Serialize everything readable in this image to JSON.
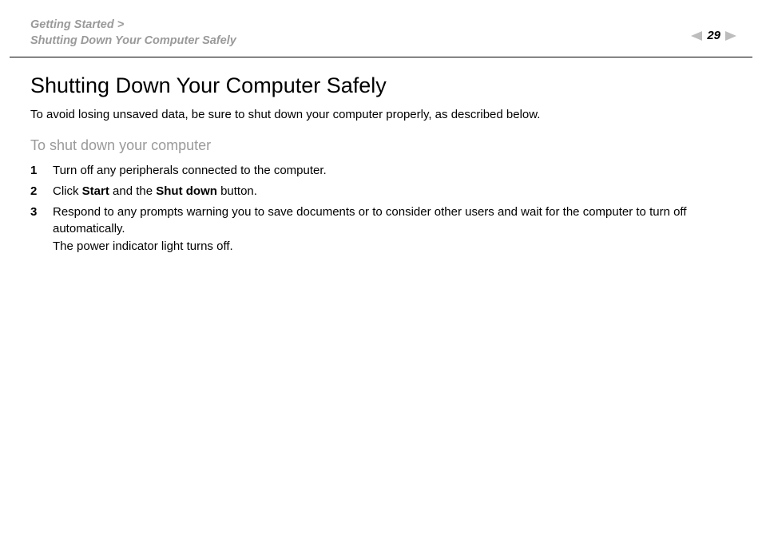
{
  "header": {
    "breadcrumb_line1": "Getting Started >",
    "breadcrumb_line2": "Shutting Down Your Computer Safely",
    "page_number": "29"
  },
  "main": {
    "title": "Shutting Down Your Computer Safely",
    "intro": "To avoid losing unsaved data, be sure to shut down your computer properly, as described below.",
    "subtitle": "To shut down your computer",
    "steps": {
      "n1": "1",
      "t1": "Turn off any peripherals connected to the computer.",
      "n2": "2",
      "t2a": "Click ",
      "t2b": "Start",
      "t2c": " and the ",
      "t2d": "Shut down",
      "t2e": " button.",
      "n3": "3",
      "t3a": "Respond to any prompts warning you to save documents or to consider other users and wait for the computer to turn off automatically.",
      "t3b": "The power indicator light turns off."
    }
  }
}
